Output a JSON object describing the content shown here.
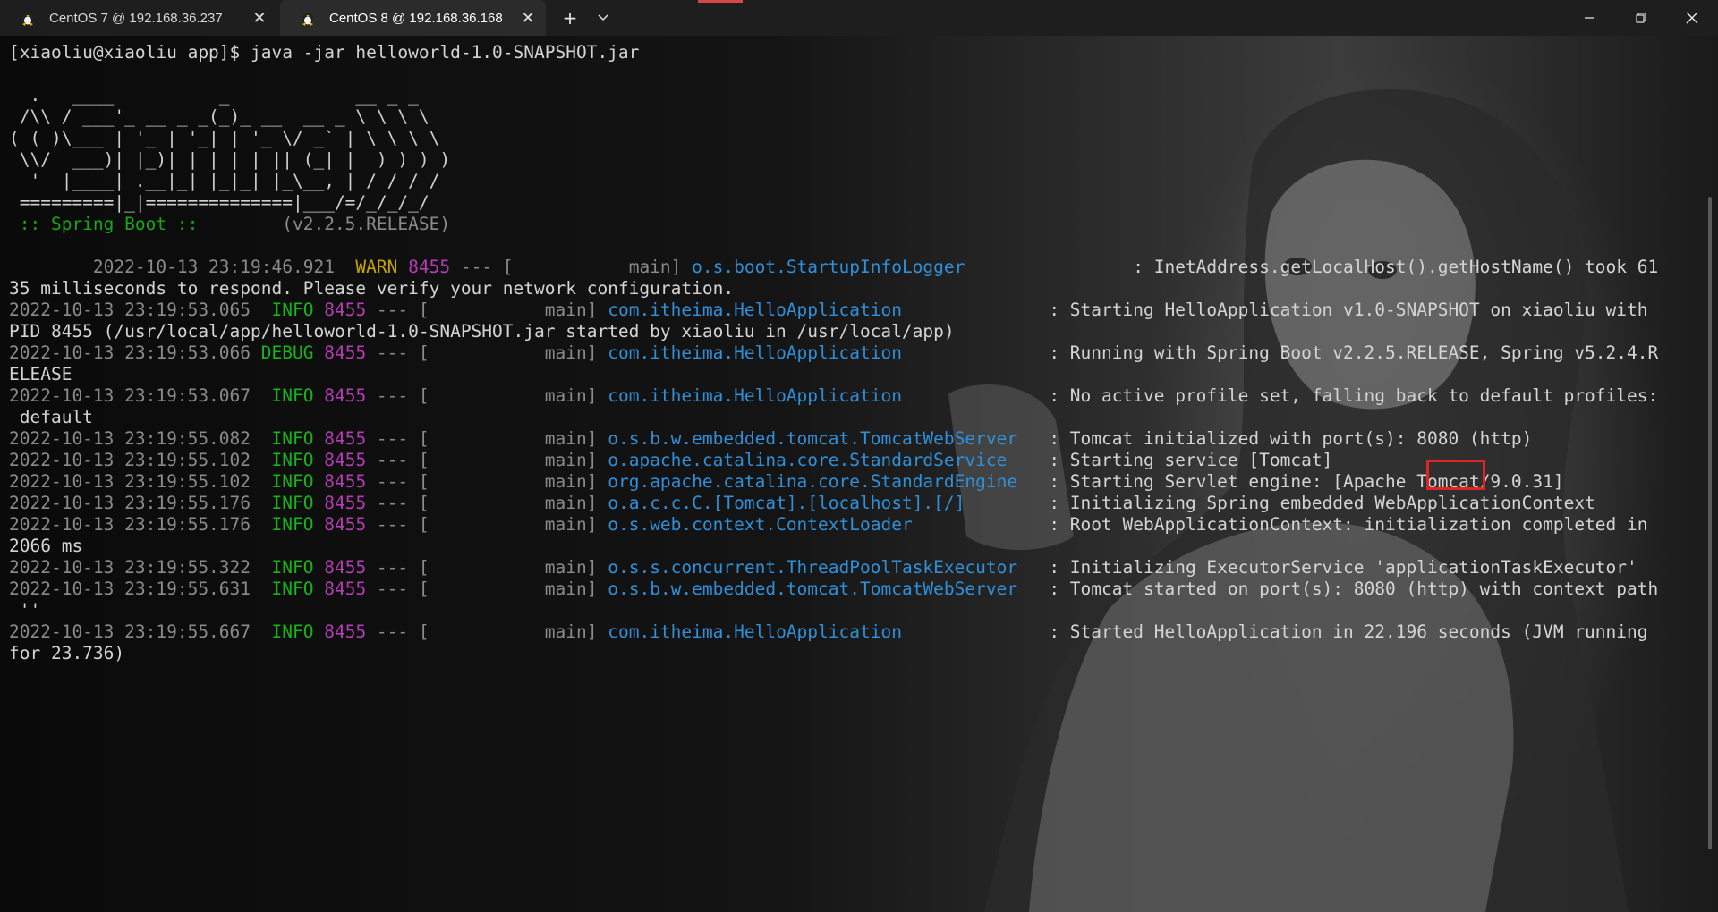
{
  "tabs": [
    {
      "title": "CentOS 7 @ 192.168.36.237",
      "icon": "linux-penguin-icon",
      "active": false
    },
    {
      "title": "CentOS 8 @ 192.168.36.168",
      "icon": "linux-penguin-icon",
      "active": true
    }
  ],
  "tab_close_glyph": "✕",
  "new_tab_glyph": "+",
  "colors": {
    "info": "#16b416",
    "warn": "#c8a400",
    "pid": "#b43cb4",
    "logger": "#2f8fd8",
    "highlight_box": "#e02323"
  },
  "terminal": {
    "command_line": "[xiaoliu@xiaoliu app]$ java -jar helloworld-1.0-SNAPSHOT.jar",
    "banner": [
      "  .   ____          _            __ _ _",
      " /\\\\ / ___'_ __ _ _(_)_ __  __ _ \\ \\ \\ \\",
      "( ( )\\___ | '_ | '_| | '_ \\/ _` | \\ \\ \\ \\",
      " \\\\/  ___)| |_)| | | | | || (_| |  ) ) ) )",
      "  '  |____| .__|_| |_|_| |_\\__, | / / / /",
      " =========|_|==============|___/=/_/_/_/"
    ],
    "spring_label": " :: Spring Boot :: ",
    "spring_version": "       (v2.2.5.RELEASE)",
    "log_lines": [
      {
        "ts": "        2022-10-13 23:19:46.921",
        "level": "  WARN",
        "level_class": "warn",
        "pid": " 8455",
        "dash": " --- [",
        "thread": "           main] ",
        "logger": "o.s.boot.StartupInfoLogger               ",
        "msg": " : InetAddress.getLocalHost().getHostName() took 61"
      },
      {
        "cont": "35 milliseconds to respond. Please verify your network configuration."
      },
      {
        "ts": "2022-10-13 23:19:53.065",
        "level": "  INFO",
        "level_class": "info",
        "pid": " 8455",
        "dash": " --- [",
        "thread": "           main] ",
        "logger": "com.itheima.HelloApplication             ",
        "msg": " : Starting HelloApplication v1.0-SNAPSHOT on xiaoliu with"
      },
      {
        "cont": "PID 8455 (/usr/local/app/helloworld-1.0-SNAPSHOT.jar started by xiaoliu in /usr/local/app)"
      },
      {
        "ts": "2022-10-13 23:19:53.066",
        "level": " DEBUG",
        "level_class": "debug",
        "pid": " 8455",
        "dash": " --- [",
        "thread": "           main] ",
        "logger": "com.itheima.HelloApplication             ",
        "msg": " : Running with Spring Boot v2.2.5.RELEASE, Spring v5.2.4.R"
      },
      {
        "cont": "ELEASE"
      },
      {
        "ts": "2022-10-13 23:19:53.067",
        "level": "  INFO",
        "level_class": "info",
        "pid": " 8455",
        "dash": " --- [",
        "thread": "           main] ",
        "logger": "com.itheima.HelloApplication             ",
        "msg": " : No active profile set, falling back to default profiles:"
      },
      {
        "cont": " default"
      },
      {
        "ts": "2022-10-13 23:19:55.082",
        "level": "  INFO",
        "level_class": "info",
        "pid": " 8455",
        "dash": " --- [",
        "thread": "           main] ",
        "logger": "o.s.b.w.embedded.tomcat.TomcatWebServer  ",
        "msg": " : Tomcat initialized with port(s): 8080 (http)"
      },
      {
        "ts": "2022-10-13 23:19:55.102",
        "level": "  INFO",
        "level_class": "info",
        "pid": " 8455",
        "dash": " --- [",
        "thread": "           main] ",
        "logger": "o.apache.catalina.core.StandardService   ",
        "msg": " : Starting service [Tomcat]"
      },
      {
        "ts": "2022-10-13 23:19:55.102",
        "level": "  INFO",
        "level_class": "info",
        "pid": " 8455",
        "dash": " --- [",
        "thread": "           main] ",
        "logger": "org.apache.catalina.core.StandardEngine  ",
        "msg": " : Starting Servlet engine: [Apache Tomcat/9.0.31]"
      },
      {
        "ts": "2022-10-13 23:19:55.176",
        "level": "  INFO",
        "level_class": "info",
        "pid": " 8455",
        "dash": " --- [",
        "thread": "           main] ",
        "logger": "o.a.c.c.C.[Tomcat].[localhost].[/]       ",
        "msg": " : Initializing Spring embedded WebApplicationContext"
      },
      {
        "ts": "2022-10-13 23:19:55.176",
        "level": "  INFO",
        "level_class": "info",
        "pid": " 8455",
        "dash": " --- [",
        "thread": "           main] ",
        "logger": "o.s.web.context.ContextLoader            ",
        "msg": " : Root WebApplicationContext: initialization completed in"
      },
      {
        "cont": "2066 ms"
      },
      {
        "ts": "2022-10-13 23:19:55.322",
        "level": "  INFO",
        "level_class": "info",
        "pid": " 8455",
        "dash": " --- [",
        "thread": "           main] ",
        "logger": "o.s.s.concurrent.ThreadPoolTaskExecutor  ",
        "msg": " : Initializing ExecutorService 'applicationTaskExecutor'"
      },
      {
        "ts": "2022-10-13 23:19:55.631",
        "level": "  INFO",
        "level_class": "info",
        "pid": " 8455",
        "dash": " --- [",
        "thread": "           main] ",
        "logger": "o.s.b.w.embedded.tomcat.TomcatWebServer  ",
        "msg": " : Tomcat started on port(s): 8080 (http) with context path"
      },
      {
        "cont": " ''"
      },
      {
        "ts": "2022-10-13 23:19:55.667",
        "level": "  INFO",
        "level_class": "info",
        "pid": " 8455",
        "dash": " --- [",
        "thread": "           main] ",
        "logger": "com.itheima.HelloApplication             ",
        "msg": " : Started HelloApplication in 22.196 seconds (JVM running"
      },
      {
        "cont": "for 23.736)"
      }
    ]
  }
}
